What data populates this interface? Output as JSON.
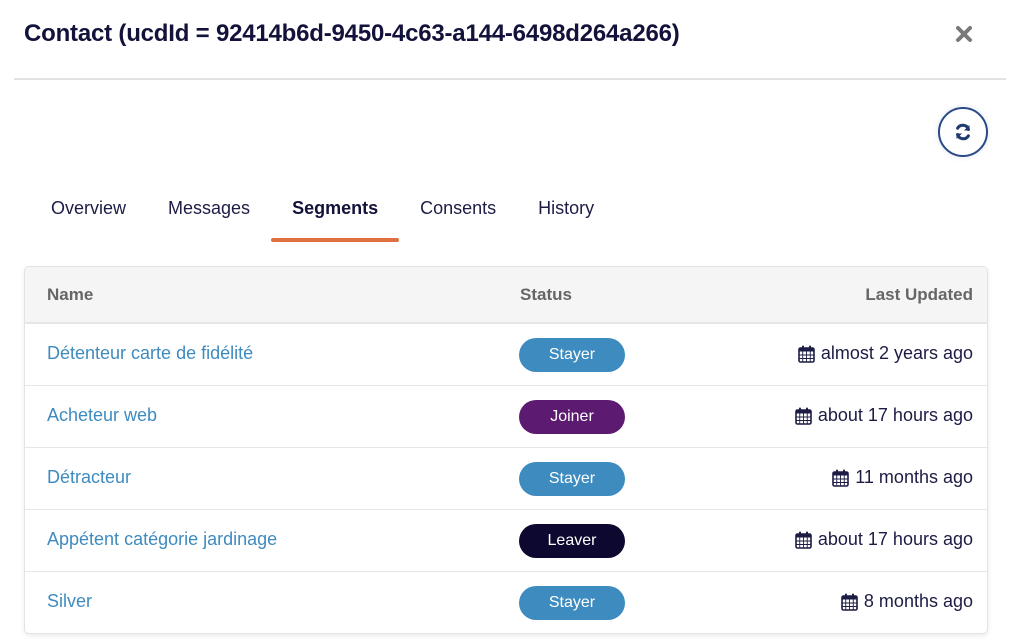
{
  "modal": {
    "title": "Contact (ucdId = 92414b6d-9450-4c63-a144-6498d264a266)",
    "close_icon": "close-icon",
    "refresh_icon": "refresh-icon"
  },
  "tabs": [
    {
      "label": "Overview",
      "active": false
    },
    {
      "label": "Messages",
      "active": false
    },
    {
      "label": "Segments",
      "active": true
    },
    {
      "label": "Consents",
      "active": false
    },
    {
      "label": "History",
      "active": false
    }
  ],
  "colors": {
    "accent_tab": "#e0703f",
    "link": "#3e8bbf",
    "stayer": "#3e8bbf",
    "joiner": "#5c1a70",
    "leaver": "#0c0830"
  },
  "table": {
    "headers": {
      "name": "Name",
      "status": "Status",
      "last_updated": "Last Updated"
    },
    "rows": [
      {
        "name": "Détenteur carte de fidélité",
        "status": "Stayer",
        "status_color": "#3e8bbf",
        "last_updated": "almost 2 years ago",
        "icon": "calendar-icon"
      },
      {
        "name": "Acheteur web",
        "status": "Joiner",
        "status_color": "#5c1a70",
        "last_updated": "about 17 hours ago",
        "icon": "calendar-icon"
      },
      {
        "name": "Détracteur",
        "status": "Stayer",
        "status_color": "#3e8bbf",
        "last_updated": "11 months ago",
        "icon": "calendar-icon"
      },
      {
        "name": "Appétent catégorie jardinage",
        "status": "Leaver",
        "status_color": "#0c0830",
        "last_updated": "about 17 hours ago",
        "icon": "calendar-icon"
      },
      {
        "name": "Silver",
        "status": "Stayer",
        "status_color": "#3e8bbf",
        "last_updated": "8 months ago",
        "icon": "calendar-icon"
      }
    ]
  }
}
